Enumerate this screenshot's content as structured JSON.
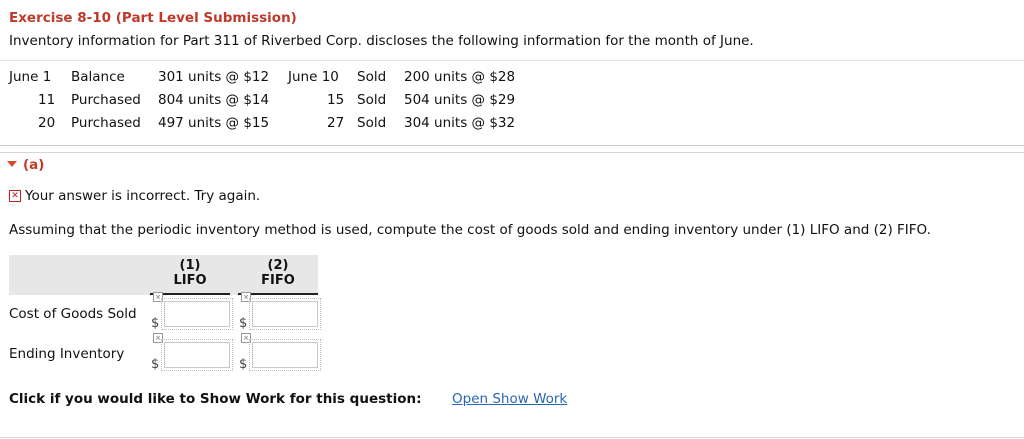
{
  "exercise": {
    "title": "Exercise 8-10 (Part Level Submission)",
    "intro": "Inventory information for Part 311 of Riverbed Corp. discloses the following information for the month of June."
  },
  "inventory": {
    "left_rows": [
      {
        "date": "June 1",
        "type": "Balance",
        "detail": "301 units @ $12"
      },
      {
        "date": "11",
        "type": "Purchased",
        "detail": "804 units @ $14"
      },
      {
        "date": "20",
        "type": "Purchased",
        "detail": "497 units @ $15"
      }
    ],
    "right_rows": [
      {
        "date": "June 10",
        "type": "Sold",
        "detail": "200 units @ $28"
      },
      {
        "date": "15",
        "type": "Sold",
        "detail": "504 units @ $29"
      },
      {
        "date": "27",
        "type": "Sold",
        "detail": "304 units @ $32"
      }
    ]
  },
  "part_a": {
    "label": "(a)",
    "error_message": "Your answer is incorrect.  Try again.",
    "question": "Assuming that the periodic inventory method is used, compute the cost of goods sold and ending inventory under (1) LIFO and (2) FIFO.",
    "columns": [
      {
        "num": "(1)",
        "name": "LIFO"
      },
      {
        "num": "(2)",
        "name": "FIFO"
      }
    ],
    "rows": [
      {
        "label": "Cost of Goods Sold",
        "currency": "$",
        "lifo_value": "",
        "fifo_value": ""
      },
      {
        "label": "Ending Inventory",
        "currency": "$",
        "lifo_value": "",
        "fifo_value": ""
      }
    ]
  },
  "show_work": {
    "prompt": "Click if you would like to Show Work for this question:",
    "link": "Open Show Work"
  },
  "colors": {
    "accent_red": "#c0392b",
    "link_blue": "#2a67b2",
    "header_band": "#e7e7e7"
  }
}
